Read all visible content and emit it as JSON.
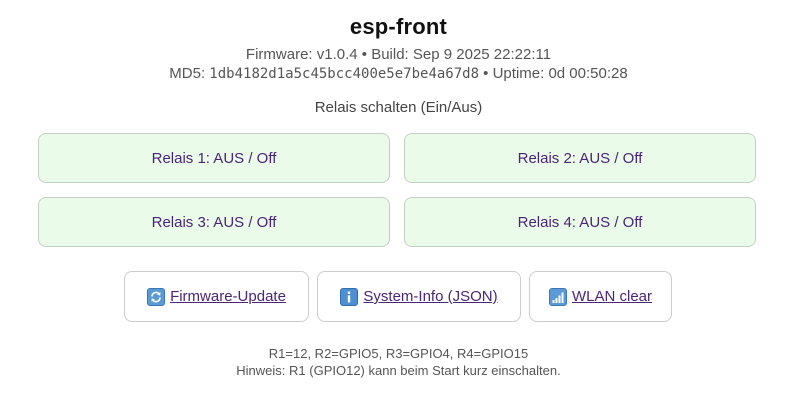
{
  "header": {
    "title": "esp-front",
    "firmware_line": "Firmware: v1.0.4 • Build: Sep 9 2025 22:22:11",
    "md5_label": "MD5: ",
    "md5_value": "1db4182d1a5c45bcc400e5e7be4a67d8",
    "uptime_text": " • Uptime: 0d 00:50:28"
  },
  "relays": {
    "heading": "Relais schalten (Ein/Aus)",
    "items": [
      {
        "label": "Relais 1: AUS / Off"
      },
      {
        "label": "Relais 2: AUS / Off"
      },
      {
        "label": "Relais 3: AUS / Off"
      },
      {
        "label": "Relais 4: AUS / Off"
      }
    ]
  },
  "actions": [
    {
      "label": "Firmware-Update",
      "icon": "refresh-icon"
    },
    {
      "label": "System-Info (JSON)",
      "icon": "info-icon"
    },
    {
      "label": "WLAN clear",
      "icon": "signal-icon"
    }
  ],
  "footer": {
    "mapping": "R1=12, R2=GPIO5, R3=GPIO4, R4=GPIO15",
    "hint": "Hinweis: R1 (GPIO12) kann beim Start kurz einschalten."
  },
  "colors": {
    "relay_bg": "#ebfbe9",
    "link": "#4b2577",
    "icon_blue": "#5b9bd5"
  }
}
